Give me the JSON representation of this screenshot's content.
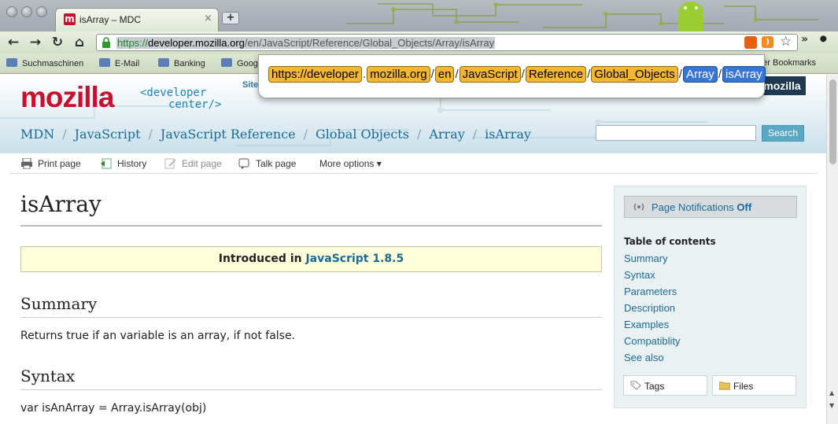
{
  "browser": {
    "tab_title": "isArray – MDC",
    "tab_favicon": "m",
    "tab_close": "×",
    "new_tab": "+",
    "back_icon": "←",
    "forward_icon": "→",
    "reload_icon": "↻",
    "home_icon": "⌂",
    "url": {
      "scheme": "https://",
      "host": "developer.mozilla.org",
      "path": "/en/JavaScript/Reference/Global_Objects/Array/isArray"
    },
    "rss_icon": "rss",
    "star_icon": "☆",
    "more_icon": "»",
    "wrench_icon": "wrench"
  },
  "bookmarks": {
    "items": [
      {
        "label": "Suchmaschinen"
      },
      {
        "label": "E-Mail"
      },
      {
        "label": "Banking"
      },
      {
        "label": "Goog"
      }
    ],
    "other": "ther Bookmarks"
  },
  "popup": {
    "segments": [
      {
        "text": "https://developer",
        "selected": false
      },
      {
        "text": "mozilla.org",
        "selected": false
      },
      {
        "text": "en",
        "selected": false
      },
      {
        "text": "JavaScript",
        "selected": false
      },
      {
        "text": "Reference",
        "selected": false
      },
      {
        "text": "Global_Objects",
        "selected": false
      },
      {
        "text": "Array",
        "selected": true
      },
      {
        "text": "isArray",
        "selected": true
      }
    ]
  },
  "header": {
    "logo": "mozilla",
    "tagline_line1": "<developer",
    "tagline_line2": "center/>",
    "site_link": "Site",
    "badge": "mozilla",
    "search_button": "Search",
    "search_value": ""
  },
  "breadcrumb": [
    "MDN",
    "JavaScript",
    "JavaScript Reference",
    "Global Objects",
    "Array",
    "isArray"
  ],
  "actions": {
    "print": "Print page",
    "history": "History",
    "edit": "Edit page",
    "talk": "Talk page",
    "more": "More options ▾"
  },
  "content": {
    "title": "isArray",
    "introduced_prefix": "Introduced in ",
    "introduced_link": "JavaScript 1.8.5",
    "summary_heading": "Summary",
    "summary_text": "Returns true if an variable is an array, if not false.",
    "syntax_heading": "Syntax",
    "syntax_code": "var isAnArray = Array.isArray(obj)"
  },
  "sidebar": {
    "notifications_label": "Page Notifications",
    "notifications_state": "Off",
    "toc_heading": "Table of contents",
    "toc": [
      "Summary",
      "Syntax",
      "Parameters",
      "Description",
      "Examples",
      "Compatiblity",
      "See also"
    ],
    "tags": "Tags",
    "files": "Files"
  },
  "colors": {
    "brand_red": "#c8102e",
    "link_blue": "#1b6a96",
    "segment_orange": "#f5b731",
    "segment_selected": "#3876d6"
  }
}
